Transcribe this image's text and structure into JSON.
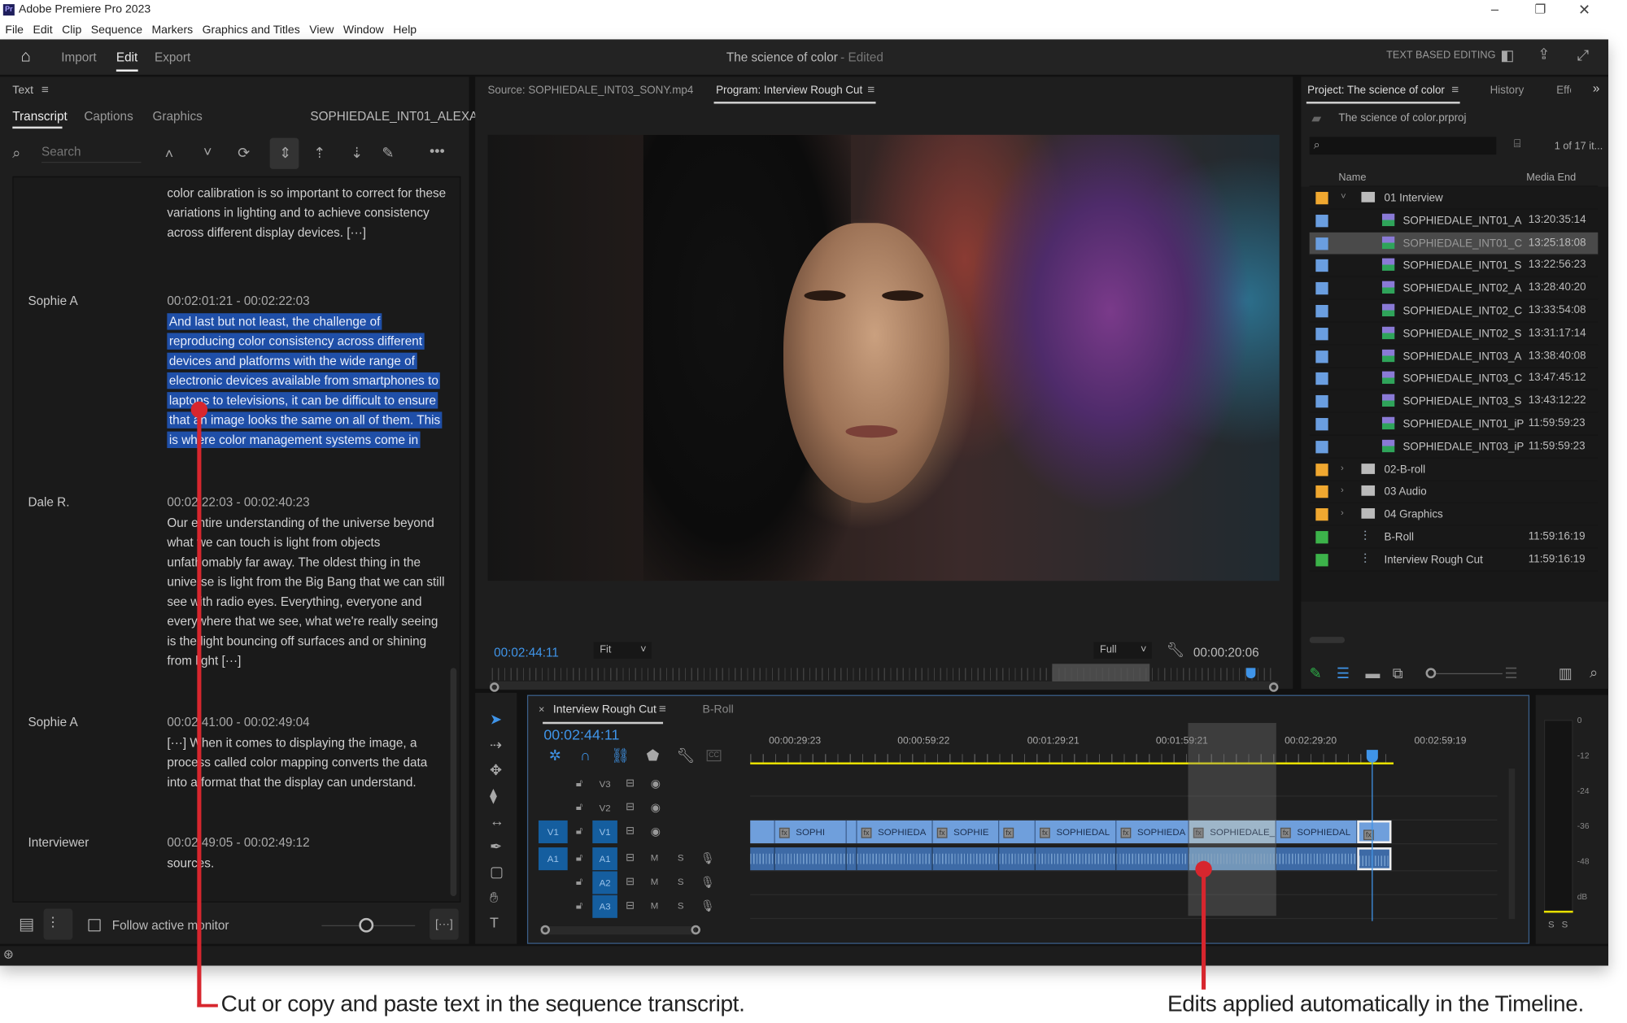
{
  "app": {
    "title": "Adobe Premiere Pro 2023",
    "logo": "Pr",
    "menu": [
      "File",
      "Edit",
      "Clip",
      "Sequence",
      "Markers",
      "Graphics and Titles",
      "View",
      "Window",
      "Help"
    ]
  },
  "header": {
    "tabs": [
      "Import",
      "Edit",
      "Export"
    ],
    "active": "Edit",
    "project_title": "The science of color",
    "edited": "- Edited",
    "text_based_editing": "TEXT BASED EDITING"
  },
  "text_panel": {
    "title": "Text",
    "tabs": [
      "Transcript",
      "Captions",
      "Graphics"
    ],
    "active_tab": "Transcript",
    "clip_name": "SOPHIEDALE_INT01_ALEXA",
    "search_placeholder": "Search",
    "entries": [
      {
        "speaker": "",
        "timecode": "",
        "text": "color calibration is so important to correct for these variations in lighting and to achieve consistency across different display devices. [···]",
        "selected": false
      },
      {
        "speaker": "Sophie A",
        "timecode": "00:02:01:21 - 00:02:22:03",
        "text": "And last but not least, the challenge of reproducing color consistency across different devices and platforms with the wide range of electronic devices available from smartphones to laptops to televisions, it can be difficult to ensure that an image looks the same on all of them. This is where color management systems come in",
        "selected": true
      },
      {
        "speaker": "Dale R.",
        "timecode": "00:02:22:03 - 00:02:40:23",
        "text": "Our entire understanding of the universe beyond what we can touch is light from objects unfathomably far away. The oldest thing in the universe is light from the Big Bang that we can still see with radio eyes. Everything, everyone and everywhere that we see, what we're really seeing is the light bouncing off surfaces and or shining from light [···]",
        "selected": false
      },
      {
        "speaker": "Sophie A",
        "timecode": "00:02:41:00 - 00:02:49:04",
        "text": "[···] When it comes to displaying the image, a process called color mapping converts the data into a format that the display can understand.",
        "selected": false
      },
      {
        "speaker": "Interviewer",
        "timecode": "00:02:49:05 - 00:02:49:12",
        "text": "sources.",
        "selected": false
      }
    ],
    "follow_active_monitor": "Follow active monitor",
    "follow_checked": false,
    "ellipsis_button": "[···]"
  },
  "monitor": {
    "source_tab": "Source: SOPHIEDALE_INT03_SONY.mp4",
    "program_tab": "Program: Interview Rough Cut",
    "timecode": "00:02:44:11",
    "fit": "Fit",
    "quality": "Full",
    "duration": "00:00:20:06"
  },
  "project": {
    "tabs": [
      "Project: The science of color",
      "History",
      "Effe"
    ],
    "file": "The science of color.prproj",
    "count": "1 of 17 it...",
    "columns": [
      "Name",
      "Media End"
    ],
    "items": [
      {
        "name": "01 Interview",
        "end": "",
        "color": "#f0a830",
        "type": "folder",
        "indent": 0,
        "open": true
      },
      {
        "name": "SOPHIEDALE_INT01_A",
        "end": "13:20:35:14",
        "color": "#6a9ee0",
        "type": "clip",
        "indent": 1
      },
      {
        "name": "SOPHIEDALE_INT01_C",
        "end": "13:25:18:08",
        "color": "#6a9ee0",
        "type": "clip",
        "indent": 1,
        "selected": true
      },
      {
        "name": "SOPHIEDALE_INT01_S",
        "end": "13:22:56:23",
        "color": "#6a9ee0",
        "type": "clip",
        "indent": 1
      },
      {
        "name": "SOPHIEDALE_INT02_A",
        "end": "13:28:40:20",
        "color": "#6a9ee0",
        "type": "clip",
        "indent": 1
      },
      {
        "name": "SOPHIEDALE_INT02_C",
        "end": "13:33:54:08",
        "color": "#6a9ee0",
        "type": "clip",
        "indent": 1
      },
      {
        "name": "SOPHIEDALE_INT02_S",
        "end": "13:31:17:14",
        "color": "#6a9ee0",
        "type": "clip",
        "indent": 1
      },
      {
        "name": "SOPHIEDALE_INT03_A",
        "end": "13:38:40:08",
        "color": "#6a9ee0",
        "type": "clip",
        "indent": 1
      },
      {
        "name": "SOPHIEDALE_INT03_C",
        "end": "13:47:45:12",
        "color": "#6a9ee0",
        "type": "clip",
        "indent": 1
      },
      {
        "name": "SOPHIEDALE_INT03_S",
        "end": "13:43:12:22",
        "color": "#6a9ee0",
        "type": "clip",
        "indent": 1
      },
      {
        "name": "SOPHIEDALE_INT01_iP",
        "end": "11:59:59:23",
        "color": "#6a9ee0",
        "type": "clip",
        "indent": 1
      },
      {
        "name": "SOPHIEDALE_INT03_iP",
        "end": "11:59:59:23",
        "color": "#6a9ee0",
        "type": "clip",
        "indent": 1
      },
      {
        "name": "02-B-roll",
        "end": "",
        "color": "#f0a830",
        "type": "folder",
        "indent": 0
      },
      {
        "name": "03 Audio",
        "end": "",
        "color": "#f0a830",
        "type": "folder",
        "indent": 0
      },
      {
        "name": "04 Graphics",
        "end": "",
        "color": "#f0a830",
        "type": "folder",
        "indent": 0
      },
      {
        "name": "B-Roll",
        "end": "11:59:16:19",
        "color": "#3cb34a",
        "type": "sequence",
        "indent": 0
      },
      {
        "name": "Interview Rough Cut",
        "end": "11:59:16:19",
        "color": "#3cb34a",
        "type": "sequence",
        "indent": 0
      }
    ]
  },
  "timeline": {
    "tabs": [
      "Interview Rough Cut",
      "B-Roll"
    ],
    "timecode": "00:02:44:11",
    "ruler": [
      "00:00:29:23",
      "00:00:59:22",
      "00:01:29:21",
      "00:01:59:21",
      "00:02:29:20",
      "00:02:59:19"
    ],
    "video_tracks": [
      "V3",
      "V2",
      "V1"
    ],
    "audio_tracks": [
      "A1",
      "A2",
      "A3"
    ],
    "mute": "M",
    "solo": "S",
    "clips": [
      "",
      "SOPHI",
      "",
      "SOPHIEDA",
      "SOPHIE",
      "",
      "SOPHIEDAL",
      "SOPHIEDA",
      "SOPHIEDALE_",
      "SOPHIEDAL",
      ""
    ]
  },
  "meter": {
    "scale": [
      "0",
      "-12",
      "-24",
      "-36",
      "-48",
      "dB"
    ],
    "solo": [
      "S",
      "S"
    ]
  },
  "annotations": {
    "left": "Cut or copy and paste text in the sequence transcript.",
    "right": "Edits applied automatically in the Timeline."
  },
  "colors": {
    "accent": "#2d8ceb",
    "selection": "#1f4fa8",
    "annotation": "#d7262e",
    "work_area": "#e8e000"
  }
}
